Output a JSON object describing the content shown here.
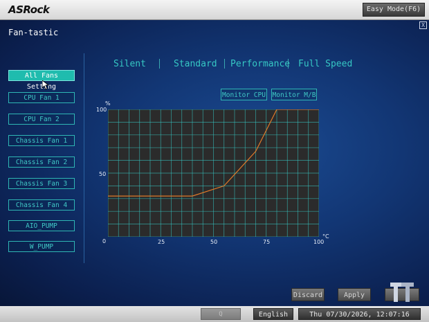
{
  "brand": "ASRock",
  "header": {
    "easy_mode_label": "Easy Mode(F6)"
  },
  "page": {
    "title": "Fan-tastic",
    "close_label": "X"
  },
  "modes": [
    "Silent",
    "Standard",
    "Performance",
    "Full Speed"
  ],
  "fans": [
    {
      "label": "All Fans Setting",
      "active": true
    },
    {
      "label": "CPU Fan 1"
    },
    {
      "label": "CPU Fan 2"
    },
    {
      "label": "Chassis Fan 1"
    },
    {
      "label": "Chassis Fan 2"
    },
    {
      "label": "Chassis Fan 3"
    },
    {
      "label": "Chassis Fan 4"
    },
    {
      "label": "AIO_PUMP"
    },
    {
      "label": "W_PUMP"
    }
  ],
  "monitor": {
    "cpu_label": "Monitor CPU",
    "mb_label": "Monitor M/B"
  },
  "chart_data": {
    "type": "line",
    "ylabel": "%",
    "xlabel": "°C",
    "xlim": [
      0,
      100
    ],
    "ylim": [
      0,
      100
    ],
    "x_ticks": [
      "0",
      "25",
      "50",
      "75",
      "100"
    ],
    "y_ticks": [
      "0",
      "50",
      "100"
    ],
    "grid": true,
    "series": [
      {
        "x": [
          0,
          40,
          55,
          70,
          80,
          100
        ],
        "values": [
          32,
          32,
          40,
          67,
          100,
          100
        ],
        "color": "#e07a2a"
      }
    ]
  },
  "actions": {
    "discard_label": "Discard",
    "apply_label": "Apply"
  },
  "footer": {
    "search_label": "Q",
    "language_label": "English",
    "datetime": "Thu 07/30/2026, 12:07:16"
  },
  "colors": {
    "accent": "#36c8c4",
    "curve": "#e07a2a",
    "background": "#0a1a44"
  }
}
